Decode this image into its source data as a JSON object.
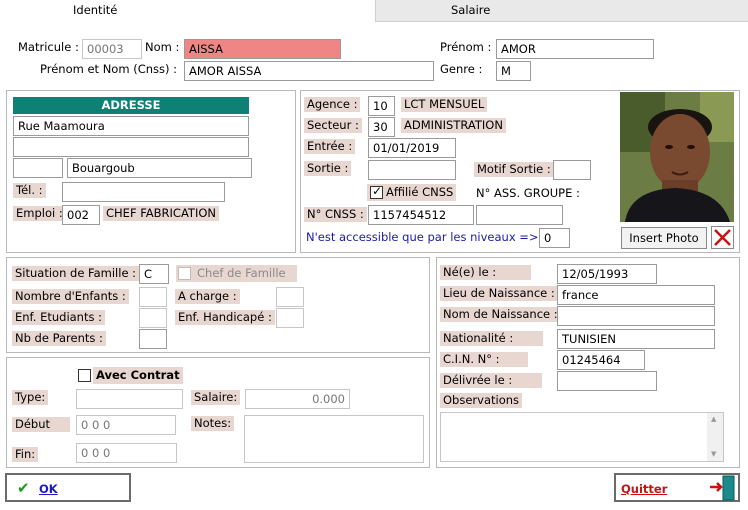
{
  "tabs": [
    "Identité",
    "Salaire"
  ],
  "identity": {
    "matricule_label": "Matricule :",
    "matricule_value": "00003",
    "nom_label": "Nom :",
    "nom_value": "AISSA",
    "prenom_label": "Prénom :",
    "prenom_value": "AMOR",
    "prenom_nom_cnss_label": "Prénom et Nom (Cnss) :",
    "prenom_nom_cnss_value": "AMOR AISSA",
    "genre_label": "Genre :",
    "genre_value": "M"
  },
  "address": {
    "header": "ADRESSE",
    "line1": "Rue Maamoura",
    "line2": "",
    "postal_code": "",
    "city": "Bouargoub",
    "tel_label": "Tél. :",
    "tel_value": "",
    "emploi_label": "Emploi :",
    "emploi_code": "002",
    "emploi_name": "CHEF FABRICATION"
  },
  "agency": {
    "agence_label": "Agence :",
    "agence_code": "10",
    "agence_name": "LCT MENSUEL",
    "secteur_label": "Secteur :",
    "secteur_code": "30",
    "secteur_name": "ADMINISTRATION",
    "entree_label": "Entrée :",
    "entree_value": "01/01/2019",
    "sortie_label": "Sortie :",
    "sortie_value": "",
    "motif_sortie_label": "Motif Sortie :",
    "motif_sortie_value": "",
    "affilie_cnss_label": "Affilié CNSS",
    "affilie_cnss_checked": true,
    "ass_groupe_label": "N° ASS. GROUPE :",
    "cnss_label": "N° CNSS :",
    "cnss_value": "1157454512",
    "cnss_extra": "",
    "access_note": "N'est accessible que par les niveaux =>",
    "access_level": "0",
    "insert_photo_label": "Insert Photo"
  },
  "family": {
    "situation_label": "Situation de Famille :",
    "situation_value": "C",
    "chef_famille_label": "Chef de Famille",
    "nb_enfants_label": "Nombre d'Enfants :",
    "a_charge_label": "A charge :",
    "enf_etudiants_label": "Enf. Etudiants :",
    "enf_handicape_label": "Enf. Handicapé :",
    "nb_parents_label": "Nb de Parents :"
  },
  "contract": {
    "avec_contrat_label": "Avec Contrat",
    "type_label": "Type:",
    "salaire_label": "Salaire:",
    "salaire_value": "0.000",
    "debut_label": "Début",
    "debut_value": "0 0  0",
    "notes_label": "Notes:",
    "fin_label": "Fin:",
    "fin_value": "0 0  0"
  },
  "birth": {
    "nee_le_label": "Né(e) le :",
    "nee_le_value": "12/05/1993",
    "lieu_naissance_label": "Lieu de Naissance :",
    "lieu_naissance_value": "france",
    "nom_naissance_label": "Nom de Naissance :",
    "nom_naissance_value": "",
    "nationalite_label": "Nationalité :",
    "nationalite_value": "TUNISIEN",
    "cin_label": "C.I.N.  N° :",
    "cin_value": "01245464",
    "delivree_label": "Délivrée le :",
    "delivree_value": "",
    "observations_label": "Observations"
  },
  "footer": {
    "ok_label": "OK",
    "quitter_label": "Quitter"
  },
  "colors": {
    "label_bg": "#e8d6d0",
    "header_teal": "#0e8075",
    "nom_field_red": "#f08585",
    "quitter_red": "#cc1111",
    "ok_blue": "#1a1acc"
  }
}
